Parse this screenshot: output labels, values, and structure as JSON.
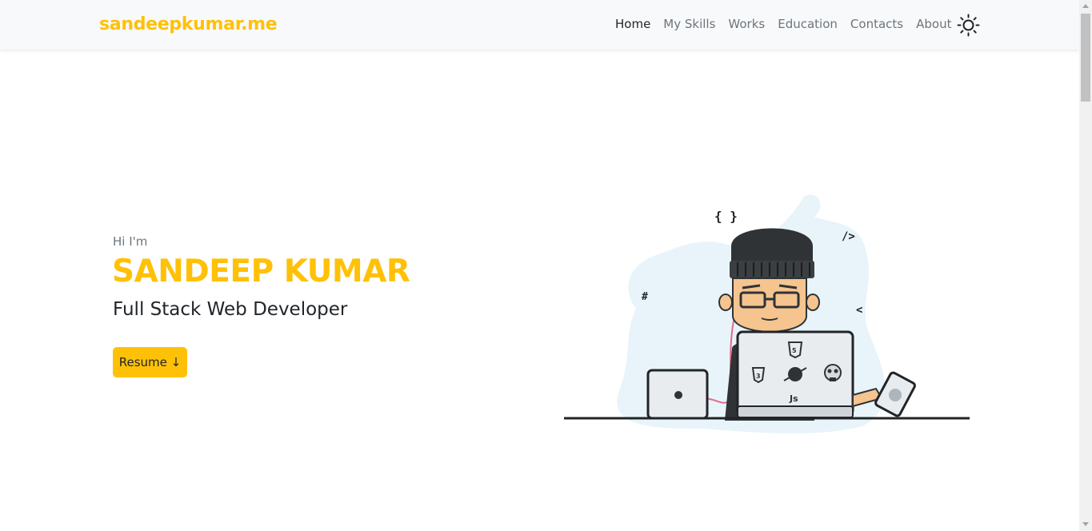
{
  "navbar": {
    "brand": "sandeepkumar.me",
    "links": [
      {
        "label": "Home",
        "active": true
      },
      {
        "label": "My Skills",
        "active": false
      },
      {
        "label": "Works",
        "active": false
      },
      {
        "label": "Education",
        "active": false
      },
      {
        "label": "Contacts",
        "active": false
      },
      {
        "label": "About",
        "active": false
      }
    ],
    "theme_toggle_icon": "sun-icon"
  },
  "hero": {
    "greeting": "Hi I'm",
    "name": "SANDEEP KUMAR",
    "role": "Full Stack Web Developer",
    "resume_label": "Resume ↓"
  },
  "illustration": {
    "symbols": [
      "{ }",
      "/>",
      "#",
      "<",
      "Js"
    ],
    "icon": "developer-at-laptop-illustration"
  },
  "colors": {
    "accent": "#ffc107",
    "navbar_bg": "#f8f9fa",
    "text_dark": "#212529",
    "text_muted": "#6c757d",
    "blob": "#e8f4f9"
  }
}
